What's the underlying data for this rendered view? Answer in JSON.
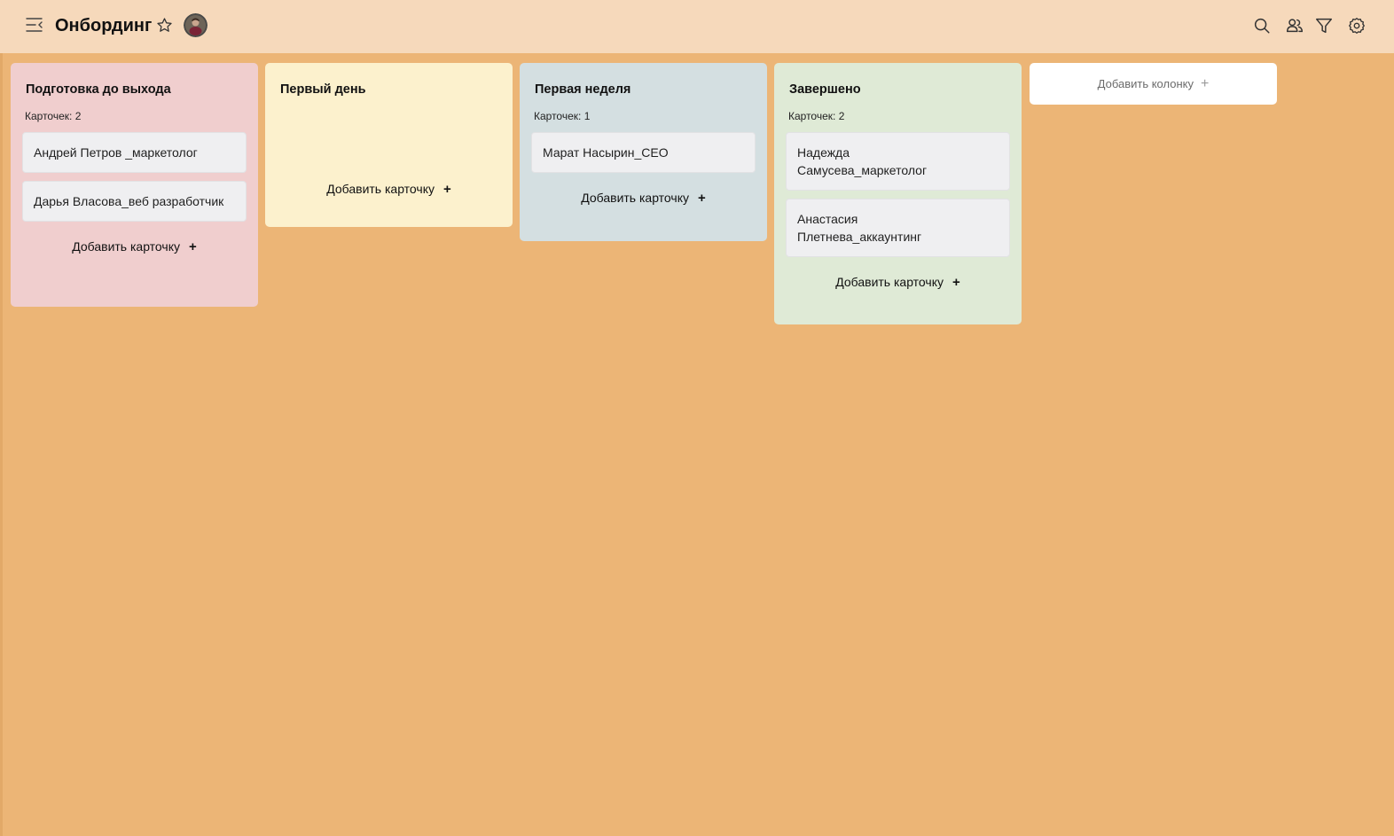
{
  "board": {
    "title": "Онбординг"
  },
  "columns": [
    {
      "title": "Подготовка до выхода",
      "count_label": "Карточек: 2",
      "color": "#f0cece",
      "cards": [
        "Андрей Петров _маркетолог",
        "Дарья Власова_веб разработчик"
      ],
      "add_label": "Добавить карточку"
    },
    {
      "title": "Первый день",
      "count_label": "",
      "color": "#fcf1cd",
      "cards": [],
      "add_label": "Добавить карточку"
    },
    {
      "title": "Первая неделя",
      "count_label": "Карточек: 1",
      "color": "#d4dfe1",
      "cards": [
        "Марат Насырин_CEO"
      ],
      "add_label": "Добавить карточку"
    },
    {
      "title": "Завершено",
      "count_label": "Карточек: 2",
      "color": "#dfead6",
      "cards": [
        "Надежда Самусева_маркетолог",
        "Анастасия Плетнева_аккаунтинг"
      ],
      "add_label": "Добавить карточку"
    }
  ],
  "add_column": {
    "label": "Добавить колонку"
  },
  "icons": {
    "menu": "menu-collapse-icon",
    "star": "star-icon",
    "search": "search-icon",
    "members": "users-icon",
    "filter": "filter-icon",
    "settings": "gear-icon"
  },
  "colors": {
    "background": "#ecb576",
    "topbar": "#f6d9bb",
    "card": "#efeff1"
  }
}
